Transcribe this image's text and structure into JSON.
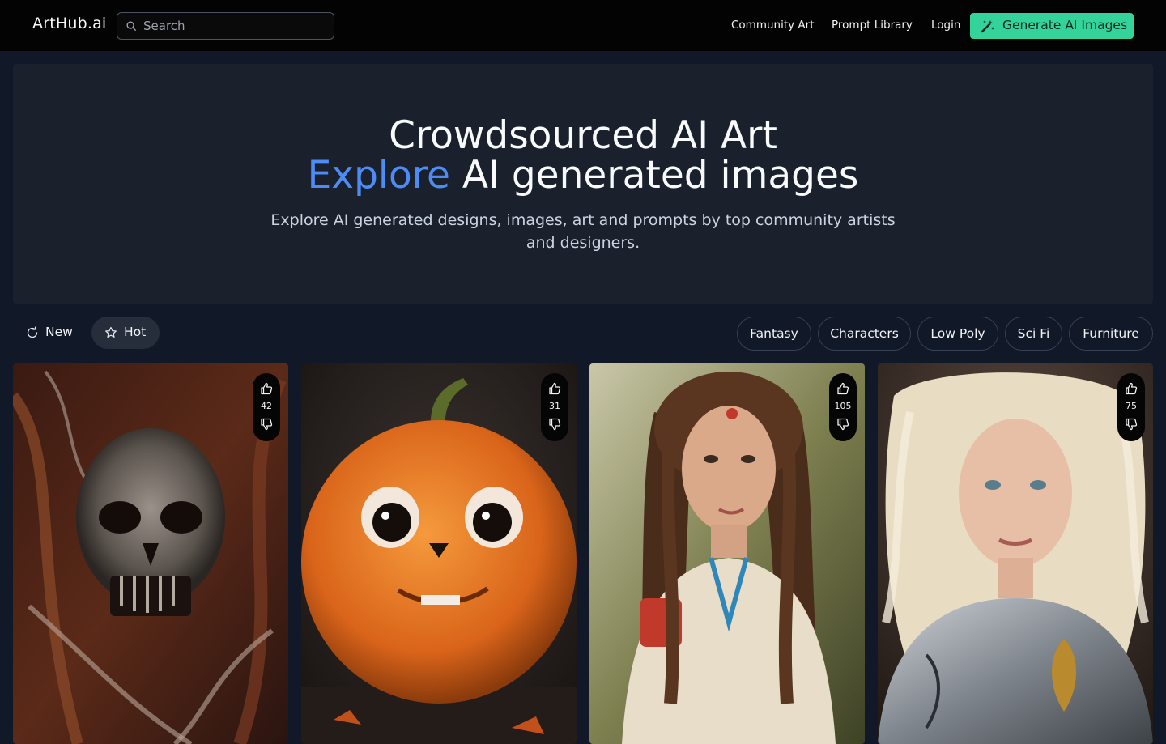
{
  "header": {
    "logo": "ArtHub.ai",
    "search_placeholder": "Search",
    "nav": [
      "Community Art",
      "Prompt Library",
      "Login"
    ],
    "cta": "Generate AI Images",
    "cta_color": "#34d399"
  },
  "hero": {
    "title_line1": "Crowdsourced AI Art",
    "title_accent": "Explore",
    "title_line2_rest": " AI generated images",
    "subtitle": "Explore AI generated designs, images, art and prompts by top community artists and designers.",
    "accent_color": "#4d8bf5"
  },
  "sort": {
    "new_label": "New",
    "hot_label": "Hot",
    "active": "Hot"
  },
  "tags": [
    "Fantasy",
    "Characters",
    "Low Poly",
    "Sci Fi",
    "Furniture"
  ],
  "cards": [
    {
      "subject": "biomechanical skull",
      "votes": "42"
    },
    {
      "subject": "furry pumpkin creature",
      "votes": "31"
    },
    {
      "subject": "native woman with braids",
      "votes": "105"
    },
    {
      "subject": "blonde woman in armor",
      "votes": "75"
    }
  ]
}
